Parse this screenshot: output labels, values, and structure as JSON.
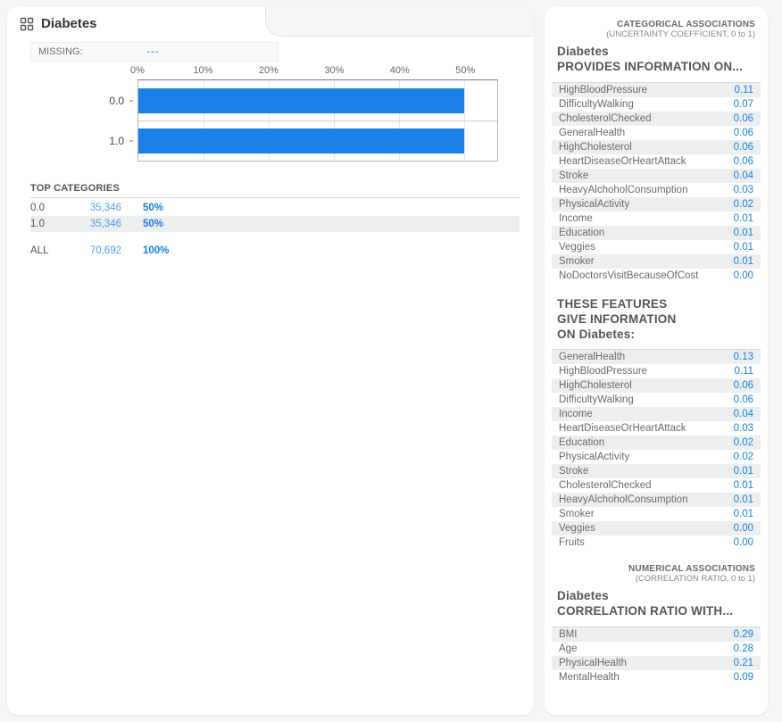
{
  "header": {
    "title": "Diabetes"
  },
  "missing": {
    "label": "MISSING:",
    "value": "---"
  },
  "chart_xticks": [
    "0%",
    "10%",
    "20%",
    "30%",
    "40%",
    "50%"
  ],
  "chart_data": {
    "type": "bar",
    "orientation": "horizontal",
    "categories": [
      "0.0",
      "1.0"
    ],
    "values": [
      50,
      50
    ],
    "xlabel": "",
    "ylabel": "",
    "xlim": [
      0,
      55
    ],
    "title": ""
  },
  "top_categories": {
    "title": "TOP CATEGORIES",
    "rows": [
      {
        "k": "0.0",
        "count": "35,346",
        "pct": "50%"
      },
      {
        "k": "1.0",
        "count": "35,346",
        "pct": "50%"
      }
    ],
    "total": {
      "k": "ALL",
      "count": "70,692",
      "pct": "100%"
    }
  },
  "cat_assoc": {
    "small_title": "CATEGORICAL ASSOCIATIONS",
    "small_sub": "(UNCERTAINTY COEFFICIENT, 0 to 1)",
    "head1": "Diabetes",
    "head2": "PROVIDES INFORMATION ON...",
    "rows": [
      {
        "name": "HighBloodPressure",
        "v": "0.11"
      },
      {
        "name": "DifficultyWalking",
        "v": "0.07"
      },
      {
        "name": "CholesterolChecked",
        "v": "0.06"
      },
      {
        "name": "GeneralHealth",
        "v": "0.06"
      },
      {
        "name": "HighCholesterol",
        "v": "0.06"
      },
      {
        "name": "HeartDiseaseOrHeartAttack",
        "v": "0.06"
      },
      {
        "name": "Stroke",
        "v": "0.04"
      },
      {
        "name": "HeavyAlchoholConsumption",
        "v": "0.03"
      },
      {
        "name": "PhysicalActivity",
        "v": "0.02"
      },
      {
        "name": "Income",
        "v": "0.01"
      },
      {
        "name": "Education",
        "v": "0.01"
      },
      {
        "name": "Veggies",
        "v": "0.01"
      },
      {
        "name": "Smoker",
        "v": "0.01"
      },
      {
        "name": "NoDoctorsVisitBecauseOfCost",
        "v": "0.00"
      }
    ]
  },
  "cat_assoc_inv": {
    "head1": "THESE FEATURES",
    "head2": "GIVE INFORMATION",
    "head3": "ON Diabetes:",
    "rows": [
      {
        "name": "GeneralHealth",
        "v": "0.13"
      },
      {
        "name": "HighBloodPressure",
        "v": "0.11"
      },
      {
        "name": "HighCholesterol",
        "v": "0.06"
      },
      {
        "name": "DifficultyWalking",
        "v": "0.06"
      },
      {
        "name": "Income",
        "v": "0.04"
      },
      {
        "name": "HeartDiseaseOrHeartAttack",
        "v": "0.03"
      },
      {
        "name": "Education",
        "v": "0.02"
      },
      {
        "name": "PhysicalActivity",
        "v": "0.02"
      },
      {
        "name": "Stroke",
        "v": "0.01"
      },
      {
        "name": "CholesterolChecked",
        "v": "0.01"
      },
      {
        "name": "HeavyAlchoholConsumption",
        "v": "0.01"
      },
      {
        "name": "Smoker",
        "v": "0.01"
      },
      {
        "name": "Veggies",
        "v": "0.00"
      },
      {
        "name": "Fruits",
        "v": "0.00"
      }
    ]
  },
  "num_assoc": {
    "small_title": "NUMERICAL ASSOCIATIONS",
    "small_sub": "(CORRELATION RATIO, 0 to 1)",
    "head1": "Diabetes",
    "head2": "CORRELATION RATIO WITH...",
    "rows": [
      {
        "name": "BMI",
        "v": "0.29"
      },
      {
        "name": "Age",
        "v": "0.28"
      },
      {
        "name": "PhysicalHealth",
        "v": "0.21"
      },
      {
        "name": "MentalHealth",
        "v": "0.09"
      }
    ]
  }
}
